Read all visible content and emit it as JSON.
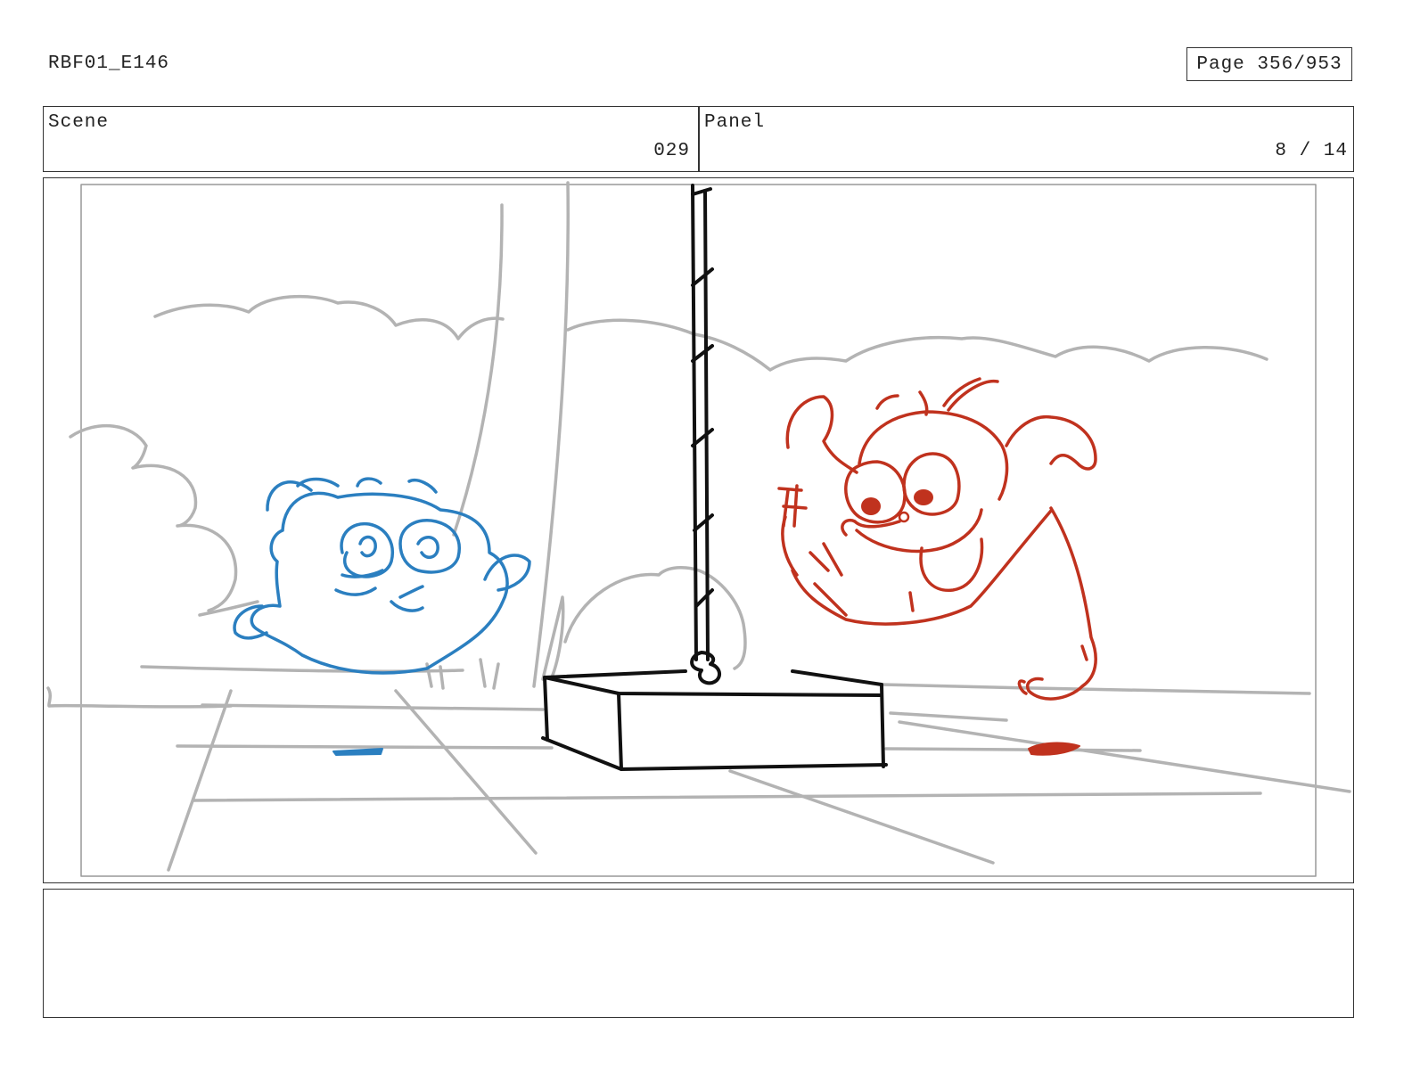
{
  "header": {
    "doc_id": "RBF01_E146",
    "page": "Page 356/953"
  },
  "info": {
    "scene_label": "Scene",
    "scene_value": "029",
    "panel_label": "Panel",
    "panel_value": "8 / 14"
  },
  "colors": {
    "frame": "#333333",
    "background_sketch": "#b3b3b3",
    "blue_character": "#2b7fc0",
    "red_character": "#c0321e",
    "ink": "#111111"
  },
  "notes": {
    "text": ""
  }
}
